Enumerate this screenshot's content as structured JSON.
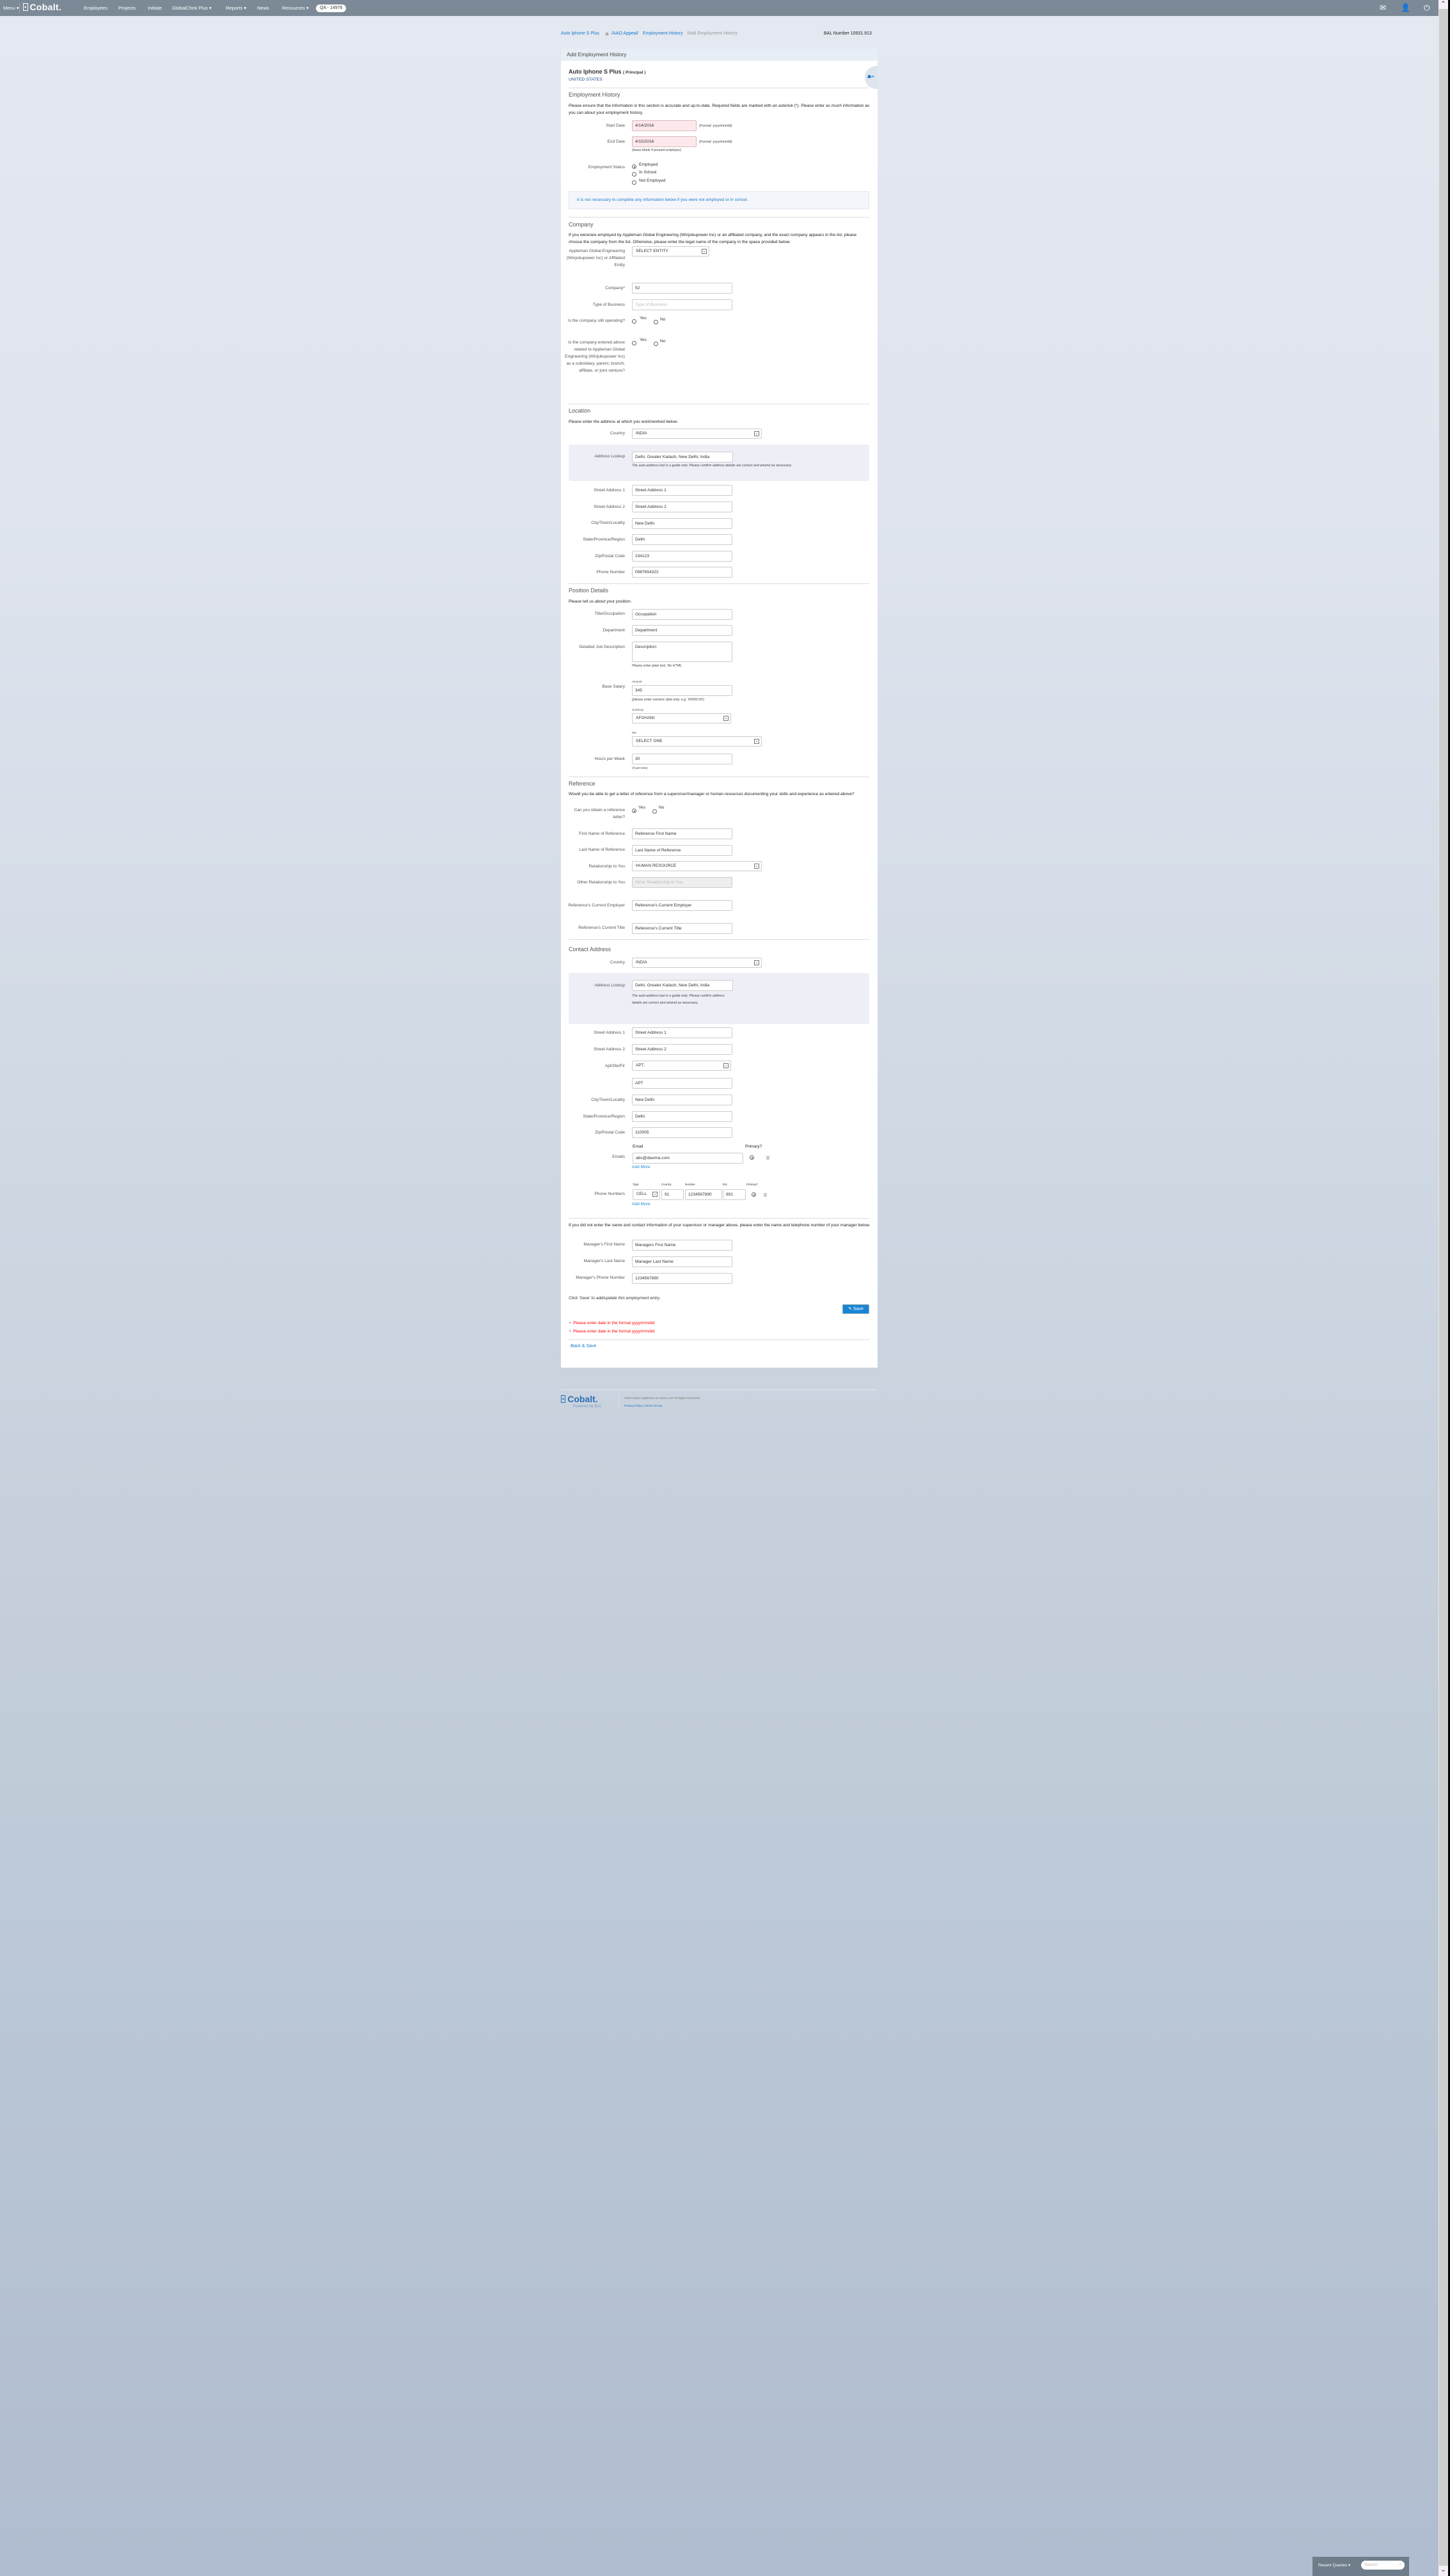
{
  "nav": {
    "menu": "Menu ▾",
    "logo": "Cobalt.",
    "items": [
      "Employees",
      "Projects",
      "Initiate",
      "GlobalChek Plus ▾",
      "Reports ▾",
      "News",
      "Resources ▾"
    ],
    "case_pill": "QA - 14976",
    "icons": [
      "mail-icon",
      "user-icon",
      "power-icon"
    ]
  },
  "breadcrumb": {
    "person": "Auto Iphone S Plus",
    "appeal": "/AAO Appeal/",
    "section": "Employment History",
    "current": "/Add Employment History",
    "bal_number": "BAL Number 10931.913"
  },
  "card": {
    "header": "Add Employment History",
    "name": "Auto Iphone S Plus",
    "role": "( Principal )",
    "country": "UNITED STATES"
  },
  "employment": {
    "title": "Employment History",
    "intro": "Please ensure that the information in this section is accurate and up-to-date. Required fields are marked with an asterisk (*). Please enter as much information as you can about your employment history.",
    "start_label": "Start Date",
    "start_value": "4/14/2016",
    "end_label": "End Date",
    "end_value": "4/15/2016",
    "format_hint": "(Format: yyyy/mm/dd)",
    "end_hint": "(leave blank if present employer)",
    "status_label": "Employment Status",
    "status_options": [
      "Employed",
      "In School",
      "Not Employed"
    ],
    "status_selected": "Employed",
    "notice": "It is not necessary to complete any information below if you were not employed or in school."
  },
  "company": {
    "title": "Company",
    "intro": "If you were/are employed by Appleman Global Engineering (Winjubupower Inc) or an affiliated company, and the exact company appears in the list, please choose the company from the list. Otherwise, please enter the legal name of the company in the space provided below.",
    "entity_label": "Appleman Global Engineering (Winjubupower Inc) or Affiliated Entity",
    "entity_value": "SELECT ENTITY",
    "company_label": "Company*",
    "company_value": "52",
    "business_label": "Type of Business",
    "business_placeholder": "Type of Business",
    "operating_label": "Is the company still operating?",
    "related_label": "Is the company entered above related to Appleman Global Engineering (Winjubupower Inc) as a subsidiary, parent, branch, affiliate, or joint venture?",
    "yes": "Yes",
    "no": "No"
  },
  "location": {
    "title": "Location",
    "intro": "Please enter the address at which you work/worked below.",
    "country_label": "Country",
    "country_value": "INDIA",
    "lookup_label": "Address Lookup",
    "lookup_value": "Delhi, Greater Kailash, New Delhi, India",
    "lookup_hint": "The auto-address tool is a guide only. Please confirm address details are correct and amend as necessary.",
    "street1_label": "Street Address 1",
    "street1_value": "Street Address 1",
    "street2_label": "Street Address 2",
    "street2_value": "Street Address 2",
    "city_label": "City/Town/Locality",
    "city_value": "New Delhi",
    "state_label": "State/Province/Region",
    "state_value": "Delhi",
    "zip_label": "Zip/Postal Code",
    "zip_value": "234123",
    "phone_label": "Phone Number",
    "phone_value": "0987654322"
  },
  "position": {
    "title": "Position Details",
    "intro": "Please tell us about your position.",
    "occupation_label": "Title/Occupation",
    "occupation_value": "Occupation",
    "department_label": "Department",
    "department_value": "Department",
    "description_label": "Detailed Job Description",
    "description_value": "Description",
    "description_hint": "Please enter plain text. No HTML.",
    "salary_label": "Base Salary",
    "amount_label": "Amount",
    "amount_value": "345",
    "amount_hint": "(please enter numeric data only, e.g. '60000.00')",
    "currency_label": "Currency",
    "currency_value": "AFGHANI",
    "per_label": "Per",
    "per_value": "SELECT ONE",
    "hours_label": "Hours per Week",
    "hours_value": "30",
    "hours_hint": "(If part-time)"
  },
  "reference": {
    "title": "Reference",
    "intro": "Would you be able to get a letter of reference from a supervisor/manager or human resources documenting your skills and experience as entered above?",
    "obtain_label": "Can you obtain a reference letter?",
    "yes": "Yes",
    "no": "No",
    "first_label": "First Name of Reference",
    "first_value": "Reference First Name",
    "last_label": "Last Name of Reference",
    "last_value": "Last Name of Reference",
    "relationship_label": "Relationship to You",
    "relationship_value": "HUMAN RESOURCE",
    "other_label": "Other Relationship to You",
    "other_placeholder": "Other Relationship to You",
    "employer_label": "Reference's Current Employer",
    "employer_value": "Reference's Current Employer",
    "ref_title_label": "Reference's Current Title",
    "ref_title_value": "Reference's Current Title"
  },
  "contact": {
    "title": "Contact Address",
    "country_label": "Country",
    "country_value": "INDIA",
    "lookup_label": "Address Lookup",
    "lookup_value": "Delhi, Greater Kailash, New Delhi, India",
    "lookup_hint": "The auto-address tool is a guide only. Please confirm address details are correct and amend as necessary.",
    "street1_label": "Street Address 1",
    "street1_value": "Street Address 1",
    "street2_label": "Street Address 2",
    "street2_value": "Street Address 2",
    "apt_label": "Apt/Ste/Flr",
    "apt_select": "APT.",
    "apt_value": "APT",
    "city_label": "City/Town/Locality",
    "city_value": "New Delhi",
    "state_label": "State/Province/Region",
    "state_value": "Delhi",
    "zip_label": "Zip/Postal Code",
    "zip_value": "110005",
    "emails_label": "Emails",
    "email_col": "Email",
    "primary_col": "Primary?",
    "email_value": "abc@daxima.com",
    "add_more": "Add More",
    "phones_label": "Phone Numbers",
    "phone_cols": [
      "Type",
      "Country",
      "Number",
      "Ext.",
      "Primary?"
    ],
    "phone_type": "CELL",
    "phone_country": "91",
    "phone_number": "1234567890",
    "phone_ext": "891"
  },
  "manager": {
    "intro": "If you did not enter the name and contact information of your supervisor or manager above, please enter the name and telephone number of your manager below.",
    "first_label": "Manager's First Name",
    "first_value": "Managers First Name",
    "last_label": "Manager's Last Name",
    "last_value": "Manager Last Name",
    "phone_label": "Manager's Phone Number",
    "phone_value": "1234567890"
  },
  "actions": {
    "save_note": "Click 'Save' to add/update this employment entry.",
    "save": "Save",
    "errors": [
      "Please enter date in the format yyyy/mm/dd",
      "Please enter date in the format yyyy/mm/dd"
    ],
    "back": "Back & Save"
  },
  "footer": {
    "logo": "Cobalt.",
    "tagline": "Powered by BAL",
    "copyright": "©2014 Berry Appleman & Leiden LLP All Rights Reserved",
    "privacy": "Privacy Policy",
    "sep": "|",
    "terms": "Terms of Use"
  },
  "recent_queries": {
    "label": "Recent Queries",
    "search_placeholder": "Search"
  },
  "colors": {
    "nav": "#7b8a96",
    "link": "#1a7ac8",
    "error": "#ff0000",
    "save": "#1a84d4"
  }
}
